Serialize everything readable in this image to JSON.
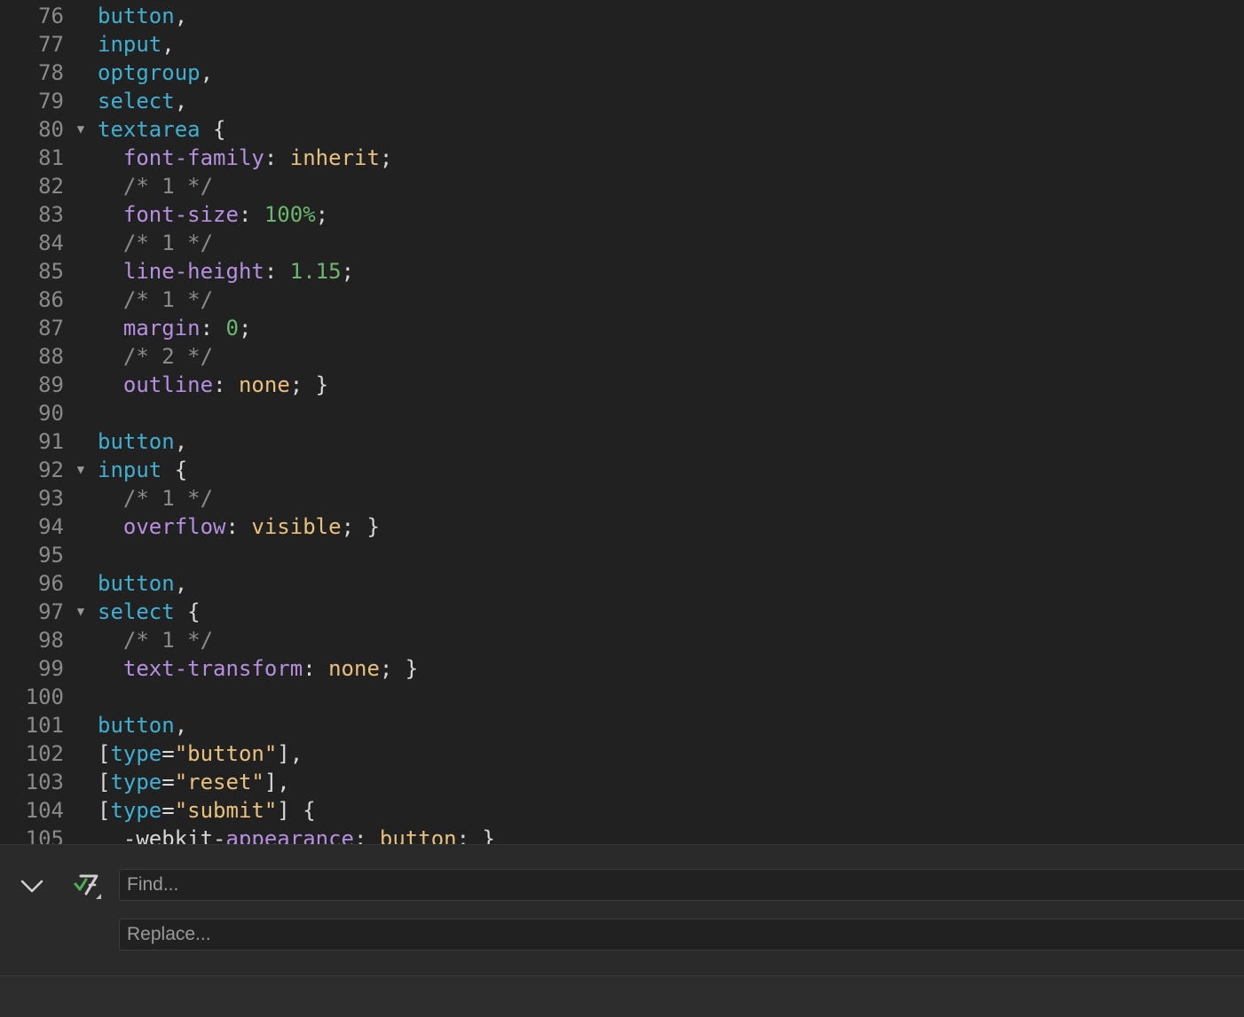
{
  "editor": {
    "lines": [
      {
        "n": "76",
        "fold": false,
        "tokens": [
          [
            "sel",
            "button"
          ],
          [
            "p",
            ","
          ]
        ]
      },
      {
        "n": "77",
        "fold": false,
        "tokens": [
          [
            "sel",
            "input"
          ],
          [
            "p",
            ","
          ]
        ]
      },
      {
        "n": "78",
        "fold": false,
        "tokens": [
          [
            "sel",
            "optgroup"
          ],
          [
            "p",
            ","
          ]
        ]
      },
      {
        "n": "79",
        "fold": false,
        "tokens": [
          [
            "sel",
            "select"
          ],
          [
            "p",
            ","
          ]
        ]
      },
      {
        "n": "80",
        "fold": true,
        "tokens": [
          [
            "sel",
            "textarea"
          ],
          [
            "p",
            " {"
          ]
        ]
      },
      {
        "n": "81",
        "fold": false,
        "tokens": [
          [
            "p",
            "  "
          ],
          [
            "prop",
            "font-family"
          ],
          [
            "p",
            ": "
          ],
          [
            "val",
            "inherit"
          ],
          [
            "p",
            ";"
          ]
        ]
      },
      {
        "n": "82",
        "fold": false,
        "tokens": [
          [
            "p",
            "  "
          ],
          [
            "com",
            "/* 1 */"
          ]
        ]
      },
      {
        "n": "83",
        "fold": false,
        "tokens": [
          [
            "p",
            "  "
          ],
          [
            "prop",
            "font-size"
          ],
          [
            "p",
            ": "
          ],
          [
            "num",
            "100%"
          ],
          [
            "p",
            ";"
          ]
        ]
      },
      {
        "n": "84",
        "fold": false,
        "tokens": [
          [
            "p",
            "  "
          ],
          [
            "com",
            "/* 1 */"
          ]
        ]
      },
      {
        "n": "85",
        "fold": false,
        "tokens": [
          [
            "p",
            "  "
          ],
          [
            "prop",
            "line-height"
          ],
          [
            "p",
            ": "
          ],
          [
            "num",
            "1.15"
          ],
          [
            "p",
            ";"
          ]
        ]
      },
      {
        "n": "86",
        "fold": false,
        "tokens": [
          [
            "p",
            "  "
          ],
          [
            "com",
            "/* 1 */"
          ]
        ]
      },
      {
        "n": "87",
        "fold": false,
        "tokens": [
          [
            "p",
            "  "
          ],
          [
            "prop",
            "margin"
          ],
          [
            "p",
            ": "
          ],
          [
            "num",
            "0"
          ],
          [
            "p",
            ";"
          ]
        ]
      },
      {
        "n": "88",
        "fold": false,
        "tokens": [
          [
            "p",
            "  "
          ],
          [
            "com",
            "/* 2 */"
          ]
        ]
      },
      {
        "n": "89",
        "fold": false,
        "tokens": [
          [
            "p",
            "  "
          ],
          [
            "prop",
            "outline"
          ],
          [
            "p",
            ": "
          ],
          [
            "val",
            "none"
          ],
          [
            "p",
            "; }"
          ]
        ]
      },
      {
        "n": "90",
        "fold": false,
        "tokens": []
      },
      {
        "n": "91",
        "fold": false,
        "tokens": [
          [
            "sel",
            "button"
          ],
          [
            "p",
            ","
          ]
        ]
      },
      {
        "n": "92",
        "fold": true,
        "tokens": [
          [
            "sel",
            "input"
          ],
          [
            "p",
            " {"
          ]
        ]
      },
      {
        "n": "93",
        "fold": false,
        "tokens": [
          [
            "p",
            "  "
          ],
          [
            "com",
            "/* 1 */"
          ]
        ]
      },
      {
        "n": "94",
        "fold": false,
        "tokens": [
          [
            "p",
            "  "
          ],
          [
            "prop",
            "overflow"
          ],
          [
            "p",
            ": "
          ],
          [
            "val",
            "visible"
          ],
          [
            "p",
            "; }"
          ]
        ]
      },
      {
        "n": "95",
        "fold": false,
        "tokens": []
      },
      {
        "n": "96",
        "fold": false,
        "tokens": [
          [
            "sel",
            "button"
          ],
          [
            "p",
            ","
          ]
        ]
      },
      {
        "n": "97",
        "fold": true,
        "tokens": [
          [
            "sel",
            "select"
          ],
          [
            "p",
            " {"
          ]
        ]
      },
      {
        "n": "98",
        "fold": false,
        "tokens": [
          [
            "p",
            "  "
          ],
          [
            "com",
            "/* 1 */"
          ]
        ]
      },
      {
        "n": "99",
        "fold": false,
        "tokens": [
          [
            "p",
            "  "
          ],
          [
            "prop",
            "text-transform"
          ],
          [
            "p",
            ": "
          ],
          [
            "val",
            "none"
          ],
          [
            "p",
            "; }"
          ]
        ]
      },
      {
        "n": "100",
        "fold": false,
        "tokens": []
      },
      {
        "n": "101",
        "fold": false,
        "tokens": [
          [
            "sel",
            "button"
          ],
          [
            "p",
            ","
          ]
        ]
      },
      {
        "n": "102",
        "fold": false,
        "tokens": [
          [
            "p",
            "["
          ],
          [
            "sel",
            "type"
          ],
          [
            "p",
            "="
          ],
          [
            "str",
            "\"button\""
          ],
          [
            "p",
            "],"
          ]
        ]
      },
      {
        "n": "103",
        "fold": false,
        "tokens": [
          [
            "p",
            "["
          ],
          [
            "sel",
            "type"
          ],
          [
            "p",
            "="
          ],
          [
            "str",
            "\"reset\""
          ],
          [
            "p",
            "],"
          ]
        ]
      },
      {
        "n": "104",
        "fold": false,
        "tokens": [
          [
            "p",
            "["
          ],
          [
            "sel",
            "type"
          ],
          [
            "p",
            "="
          ],
          [
            "str",
            "\"submit\""
          ],
          [
            "p",
            "] {"
          ]
        ]
      },
      {
        "n": "105",
        "fold": false,
        "tokens": [
          [
            "p",
            "  "
          ],
          [
            "p",
            "-webkit-"
          ],
          [
            "prop",
            "appearance"
          ],
          [
            "p",
            ": "
          ],
          [
            "val",
            "button"
          ],
          [
            "p",
            "; }"
          ]
        ]
      }
    ],
    "fold_glyph": "▼"
  },
  "find_panel": {
    "find_placeholder": "Find...",
    "replace_placeholder": "Replace...",
    "colors": {
      "regex_check": "#4caf50",
      "panel_bg": "#2a2a2a"
    },
    "icons": {
      "collapse": "chevron-down-icon",
      "regex": "regex-toggle-icon"
    }
  }
}
